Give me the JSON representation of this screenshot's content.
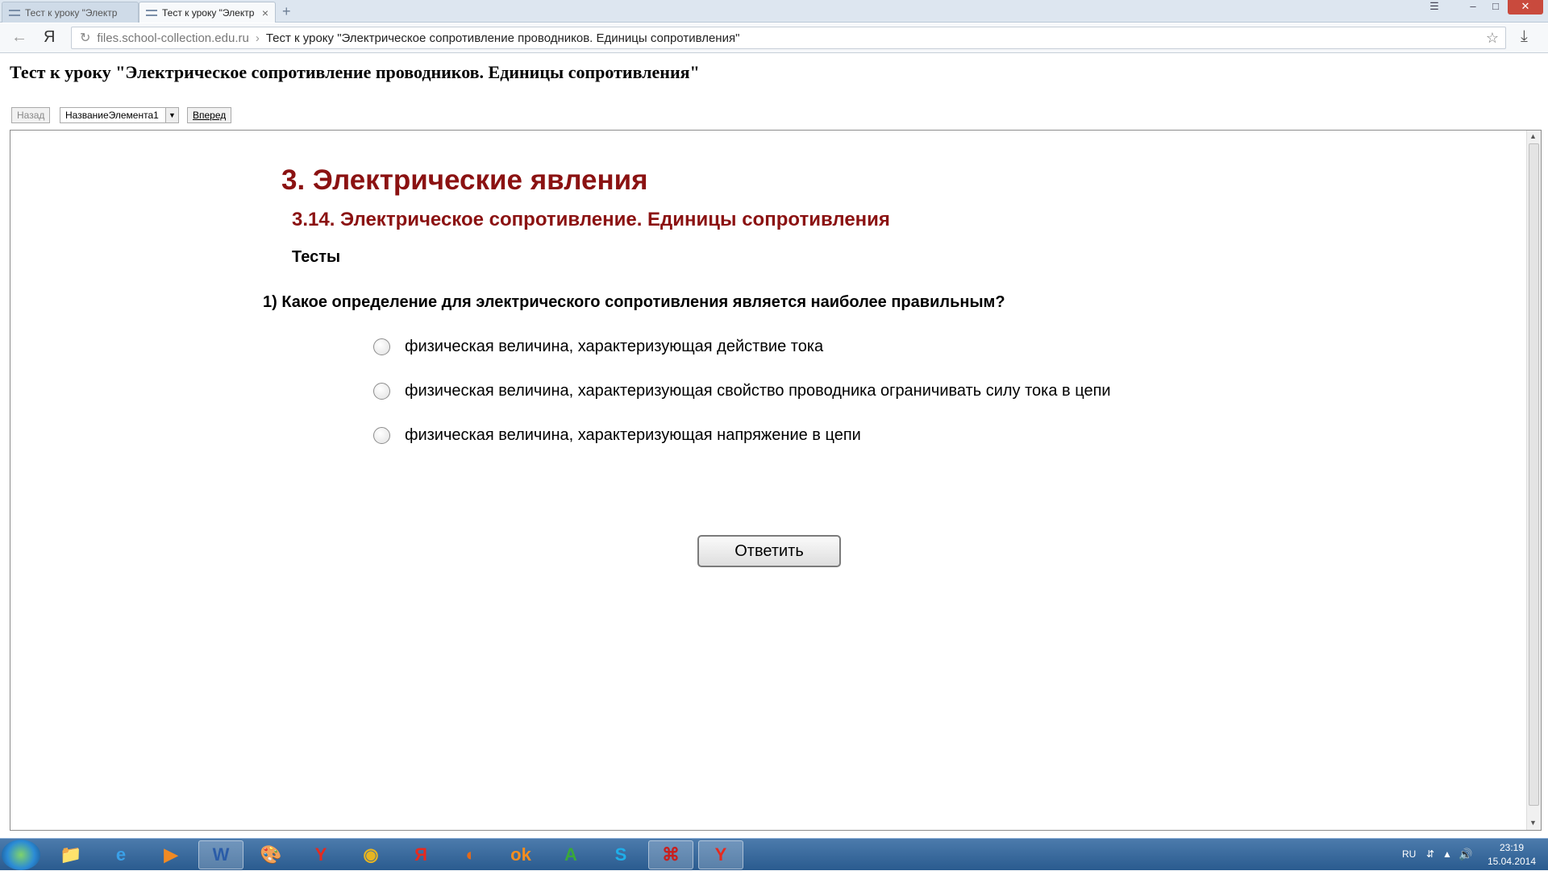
{
  "browser": {
    "tabs": [
      {
        "label": "Тест к уроку \"Электр",
        "active": false
      },
      {
        "label": "Тест к уроку \"Электр",
        "active": true
      }
    ],
    "new_tab": "+",
    "window_controls": {
      "menu": "☰",
      "minimize": "–",
      "maximize": "□",
      "close": "✕"
    },
    "nav": {
      "back": "←",
      "yandex": "Я",
      "reload": "↻"
    },
    "address": {
      "domain": "files.school-collection.edu.ru",
      "separator": "›",
      "page_title": "Тест к уроку \"Электрическое сопротивление проводников. Единицы сопротивления\""
    },
    "bookmark_icon": "☆",
    "download_icon": "⤓"
  },
  "page": {
    "title": "Тест к уроку \"Электрическое сопротивление проводников. Единицы сопротивления\"",
    "nav_back": "Назад",
    "select_value": "НазваниеЭлемента1",
    "nav_forward": "Вперед"
  },
  "lesson": {
    "chapter": "3. Электрические явления",
    "section": "3.14. Электрическое сопротивление. Единицы сопротивления",
    "subtitle": "Тесты",
    "question": "1) Какое определение для электрического сопротивления является наиболее правильным?",
    "options": [
      "физическая величина, характеризующая действие тока",
      "физическая величина, характеризующая свойство проводника ограничивать силу тока в цепи",
      "физическая величина, характеризующая напряжение в цепи"
    ],
    "answer_button": "Ответить"
  },
  "taskbar": {
    "apps": [
      {
        "name": "explorer",
        "glyph": "📁",
        "color": "#f2c94c"
      },
      {
        "name": "internet-explorer",
        "glyph": "e",
        "color": "#3aa0e8"
      },
      {
        "name": "media-player",
        "glyph": "▶",
        "color": "#f08a24"
      },
      {
        "name": "word",
        "glyph": "W",
        "color": "#2a5ca8"
      },
      {
        "name": "paint",
        "glyph": "🎨",
        "color": "#ddd"
      },
      {
        "name": "yandex-browser",
        "glyph": "Y",
        "color": "#e62a1f"
      },
      {
        "name": "chrome",
        "glyph": "◉",
        "color": "#e7b521"
      },
      {
        "name": "yandex",
        "glyph": "Я",
        "color": "#e62a1f"
      },
      {
        "name": "firefox",
        "glyph": "◐",
        "color": "#e36a1a"
      },
      {
        "name": "odnoklassniki",
        "glyph": "ok",
        "color": "#f58d1f"
      },
      {
        "name": "abbyy",
        "glyph": "A",
        "color": "#3aa83a"
      },
      {
        "name": "skype",
        "glyph": "S",
        "color": "#1faee9"
      },
      {
        "name": "adobe-reader",
        "glyph": "⌘",
        "color": "#c8201f"
      },
      {
        "name": "yandex-browser-2",
        "glyph": "Y",
        "color": "#e62a1f"
      }
    ],
    "tray": {
      "lang": "RU",
      "time": "23:19",
      "date": "15.04.2014"
    }
  }
}
